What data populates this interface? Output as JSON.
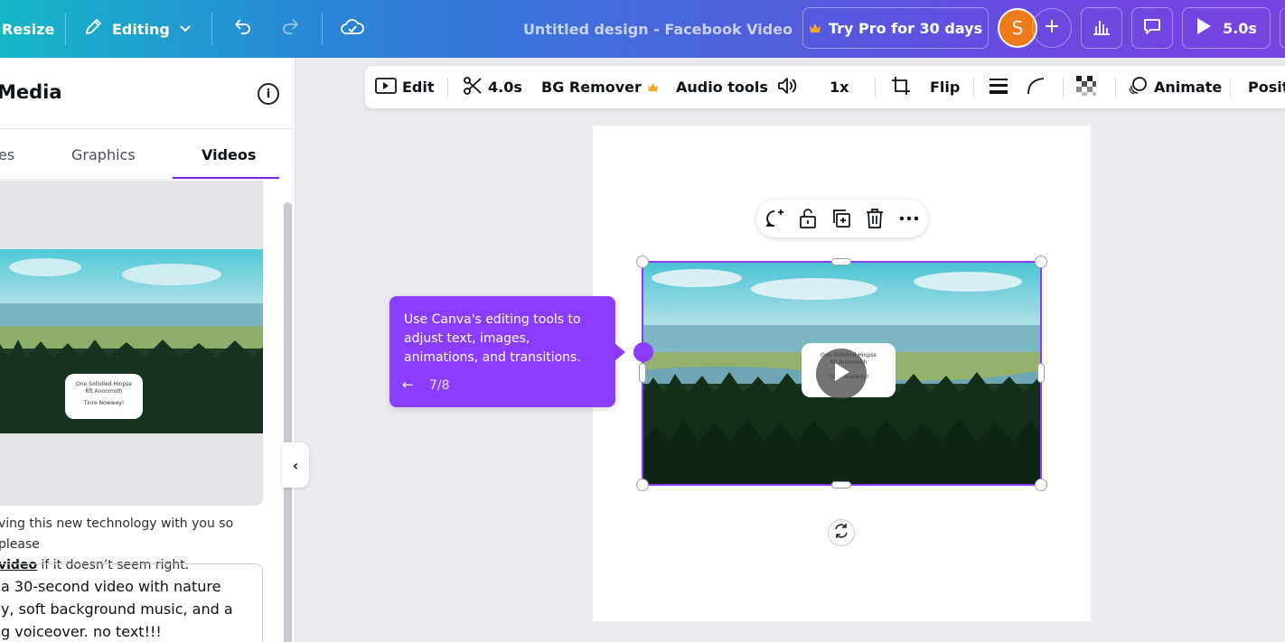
{
  "topbar": {
    "resize_label": "Resize",
    "editing_label": "Editing",
    "title": "Untitled design - Facebook Video",
    "pro_label": "Try Pro for 30 days",
    "avatar_letter": "S",
    "play_duration": "5.0s"
  },
  "left_panel": {
    "title": "Media",
    "tabs": [
      "es",
      "Graphics",
      "Videos"
    ],
    "active_tab": "Videos",
    "thumbnail_bubble_line1": "One Sollolled Hinpse",
    "thumbnail_bubble_line2": "Rlt Anonmoth",
    "thumbnail_bubble_line3": "Tinre Nowwey!",
    "note_text": "ving this new technology with you so please",
    "note_link": "video",
    "note_tail": " if it doesn’t seem right.",
    "prompt_lines": [
      "a 30-second video with nature",
      "y, soft background music, and a",
      "g voiceover. no text!!!"
    ]
  },
  "context_toolbar": {
    "edit": "Edit",
    "duration": "4.0s",
    "bg_remover": "BG Remover",
    "audio_tools": "Audio tools",
    "speed": "1x",
    "flip": "Flip",
    "animate": "Animate",
    "position": "Posit"
  },
  "tooltip": {
    "text": "Use Canva's editing tools to adjust text, images, animations, and transitions.",
    "step": "7/8",
    "back_arrow": "←"
  },
  "video_bubble": {
    "line1": "One Sollolled Hinpse",
    "line2": "Rlt Anonmoth",
    "line3": "Tinre Nowwey!"
  },
  "colors": {
    "accent": "#8b3dff",
    "avatar": "#ef7a1a",
    "crown": "#f5a623"
  }
}
